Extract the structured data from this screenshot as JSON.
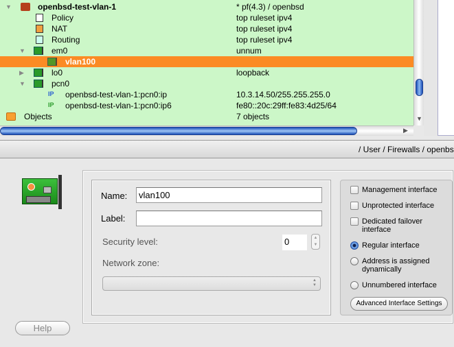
{
  "tree": {
    "rows": [
      {
        "name": "openbsd-test-vlan-1",
        "value": " * pf(4.3) / openbsd",
        "icon": "firewall-icon"
      },
      {
        "name": "Policy",
        "value": "top ruleset ipv4",
        "icon": "policy-icon"
      },
      {
        "name": "NAT",
        "value": "top ruleset ipv4",
        "icon": "nat-icon"
      },
      {
        "name": "Routing",
        "value": "top ruleset ipv4",
        "icon": "routing-icon"
      },
      {
        "name": "em0",
        "value": " unnum",
        "icon": "interface-icon"
      },
      {
        "name": "vlan100",
        "value": "",
        "icon": "interface-icon",
        "selected": true
      },
      {
        "name": "lo0",
        "value": "loopback",
        "icon": "interface-icon"
      },
      {
        "name": "pcn0",
        "value": "",
        "icon": "interface-icon"
      },
      {
        "name": "openbsd-test-vlan-1:pcn0:ip",
        "value": "10.3.14.50/255.255.255.0",
        "icon": "ipv4-address-icon"
      },
      {
        "name": "openbsd-test-vlan-1:pcn0:ip6",
        "value": "fe80::20c:29ff:fe83:4d25/64",
        "icon": "ipv6-address-icon"
      },
      {
        "name": "Objects",
        "value": "7  objects",
        "icon": "folder-icon"
      }
    ],
    "colors": {
      "background": "#ccf7c8",
      "selection": "#fb8b24"
    }
  },
  "path": "/ User / Firewalls / openbs",
  "form": {
    "name_label": "Name:",
    "name_value": "vlan100",
    "label_label": "Label:",
    "label_value": "",
    "security_label": "Security level:",
    "security_value": "0",
    "zone_label": "Network zone:",
    "zone_value": ""
  },
  "options": {
    "checkboxes": [
      {
        "label": "Management interface",
        "checked": false
      },
      {
        "label": "Unprotected interface",
        "checked": false
      },
      {
        "label": "Dedicated failover interface",
        "checked": false
      }
    ],
    "radios": [
      {
        "label": "Regular interface",
        "selected": true
      },
      {
        "label": "Address is assigned dynamically",
        "selected": false
      },
      {
        "label": "Unnumbered interface",
        "selected": false
      }
    ],
    "advanced_button": "Advanced Interface Settings"
  },
  "help_button": "Help"
}
